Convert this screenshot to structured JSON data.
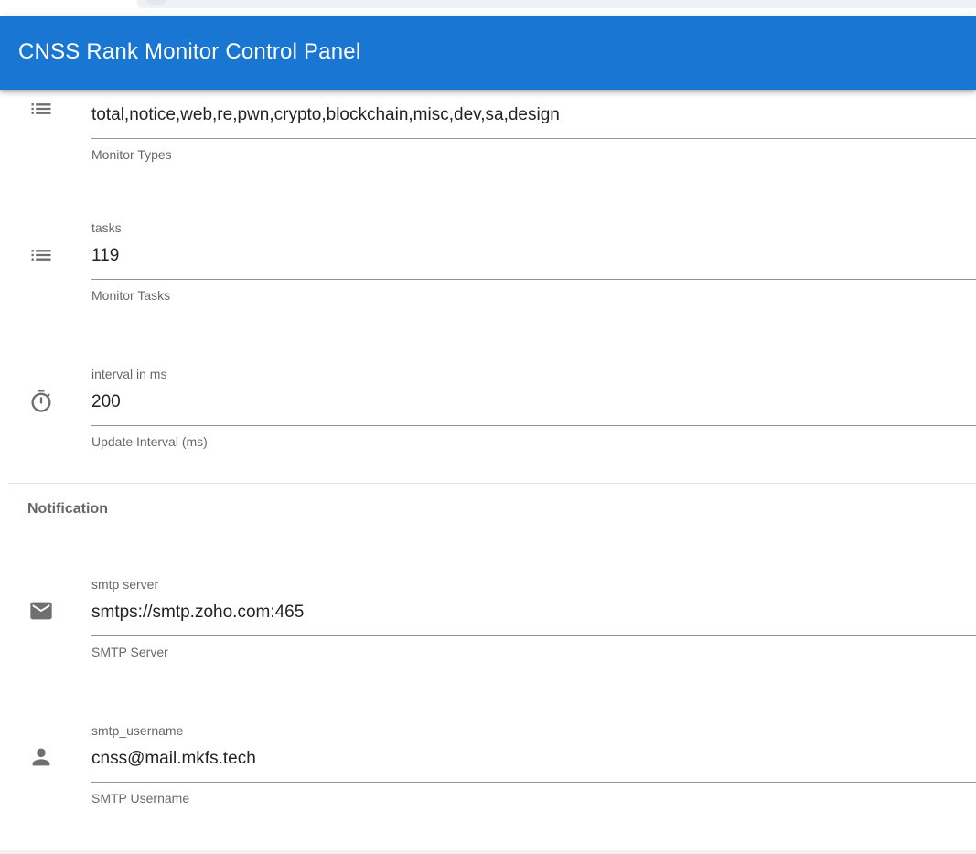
{
  "app": {
    "title": "CNSS Rank Monitor Control Panel"
  },
  "settings": {
    "monitor_types": {
      "label": "",
      "value": "total,notice,web,re,pwn,crypto,blockchain,misc,dev,sa,design",
      "helper": "Monitor Types",
      "icon": "list-icon"
    },
    "monitor_tasks": {
      "label": "tasks",
      "value": "119",
      "helper": "Monitor Tasks",
      "icon": "list-icon"
    },
    "update_interval": {
      "label": "interval in ms",
      "value": "200",
      "helper": "Update Interval (ms)",
      "icon": "timer-icon"
    }
  },
  "notification": {
    "section_title": "Notification",
    "smtp_server": {
      "label": "smtp server",
      "value": "smtps://smtp.zoho.com:465",
      "helper": "SMTP Server",
      "icon": "email-icon"
    },
    "smtp_username": {
      "label": "smtp_username",
      "value": "cnss@mail.mkfs.tech",
      "helper": "SMTP Username",
      "icon": "person-icon"
    }
  },
  "colors": {
    "app_bar": "#1976d2",
    "icon": "#6f6f6f"
  }
}
